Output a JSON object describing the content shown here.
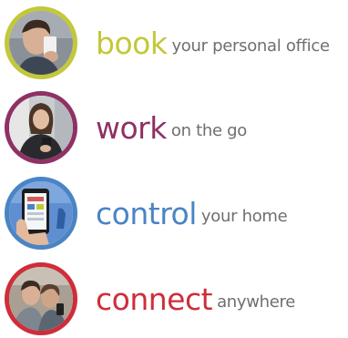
{
  "rows": [
    {
      "keyword": "book",
      "rest": "your personal office",
      "accent": "#c2c83a",
      "photo_icon": "person-with-phone-photo"
    },
    {
      "keyword": "work",
      "rest": "on the go",
      "accent": "#8f3165",
      "photo_icon": "woman-with-phone-photo"
    },
    {
      "keyword": "control",
      "rest": "your home",
      "accent": "#4a84c4",
      "photo_icon": "hand-holding-phone-photo"
    },
    {
      "keyword": "connect",
      "rest": "anywhere",
      "accent": "#cf2d3a",
      "photo_icon": "people-taking-selfie-photo"
    }
  ]
}
